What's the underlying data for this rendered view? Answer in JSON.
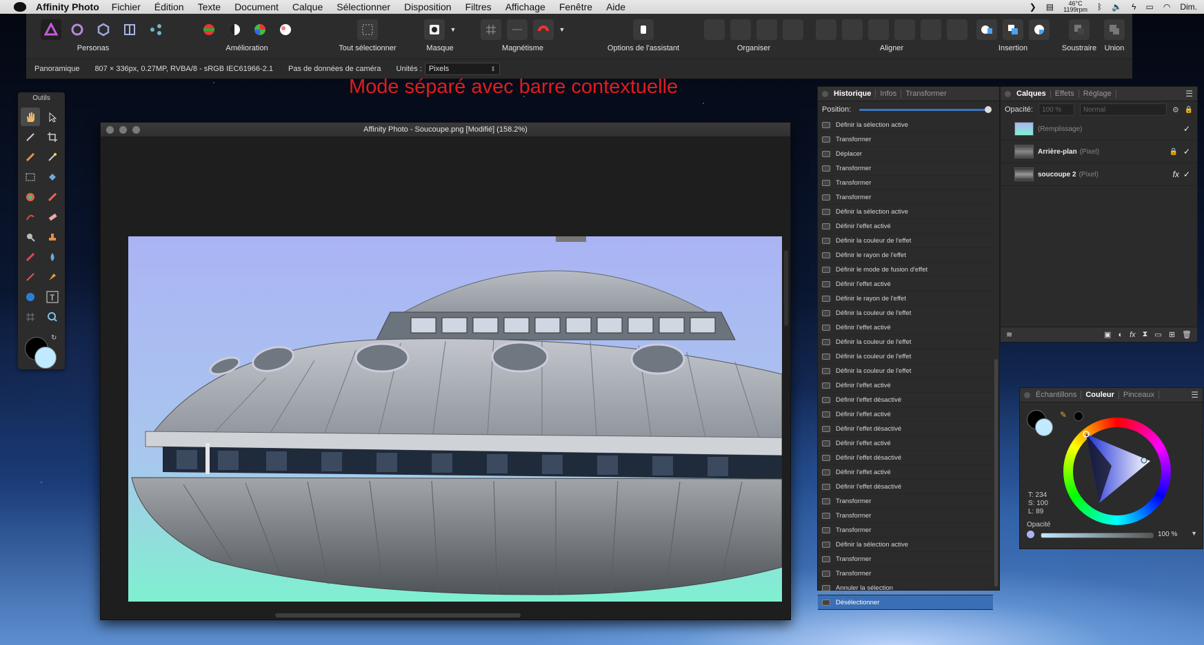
{
  "menubar": {
    "app_name": "Affinity Photo",
    "items": [
      "Fichier",
      "Édition",
      "Texte",
      "Document",
      "Calque",
      "Sélectionner",
      "Disposition",
      "Filtres",
      "Affichage",
      "Fenêtre",
      "Aide"
    ],
    "temp": "46°C",
    "rpm": "1199rpm",
    "user": "Dim."
  },
  "toolbar": {
    "personas_label": "Personas",
    "amelioration_label": "Amélioration",
    "select_all_label": "Tout sélectionner",
    "mask_label": "Masque",
    "snapping_label": "Magnétisme",
    "assistant_label": "Options de l'assistant",
    "arrange_label": "Organiser",
    "align_label": "Aligner",
    "insert_label": "Insertion",
    "subtract_label": "Soustraire",
    "union_label": "Union"
  },
  "context_bar": {
    "type": "Panoramique",
    "info": "807 × 336px, 0.27MP, RVBA/8 - sRGB IEC61966-2.1",
    "camera": "Pas de données de caméra",
    "units_label": "Unités :",
    "units_value": "Pixels"
  },
  "caption": "Mode séparé avec barre contextuelle",
  "tools_panel": {
    "title": "Outils"
  },
  "document": {
    "title": "Affinity Photo - Soucoupe.png [Modifié] (158.2%)"
  },
  "history_panel": {
    "tabs": [
      "Historique",
      "Infos",
      "Transformer"
    ],
    "active_tab": "Historique",
    "position_label": "Position:",
    "position_value": 1.0,
    "items": [
      "Définir la sélection active",
      "Transformer",
      "Déplacer",
      "Transformer",
      "Transformer",
      "Transformer",
      "Définir la sélection active",
      "Définir l'effet activé",
      "Définir la couleur de l'effet",
      "Définir le rayon de l'effet",
      "Définir le mode de fusion d'effet",
      "Définir l'effet activé",
      "Définir le rayon de l'effet",
      "Définir la couleur de l'effet",
      "Définir l'effet activé",
      "Définir la couleur de l'effet",
      "Définir la couleur de l'effet",
      "Définir la couleur de l'effet",
      "Définir l'effet activé",
      "Définir l'effet désactivé",
      "Définir l'effet activé",
      "Définir l'effet désactivé",
      "Définir l'effet activé",
      "Définir l'effet désactivé",
      "Définir l'effet activé",
      "Définir l'effet désactivé",
      "Transformer",
      "Transformer",
      "Transformer",
      "Définir la sélection active",
      "Transformer",
      "Transformer",
      "Annuler la sélection",
      "Désélectionner"
    ],
    "selected_index": 33
  },
  "layers_panel": {
    "tabs": [
      "Calques",
      "Effets",
      "Réglage"
    ],
    "active_tab": "Calques",
    "opacity_label": "Opacité:",
    "opacity_value": "100 %",
    "blend_mode": "Normal",
    "layers": [
      {
        "name": "(Remplissage)",
        "kind": "",
        "fx": false,
        "locked": false,
        "visible_mark": "✓"
      },
      {
        "name": "Arrière-plan",
        "kind": "(Pixel)",
        "fx": false,
        "locked": true,
        "visible_mark": "✓"
      },
      {
        "name": "soucoupe  2",
        "kind": "(Pixel)",
        "fx": true,
        "locked": false,
        "visible_mark": "✓"
      }
    ],
    "fx_label": "fx"
  },
  "color_panel": {
    "tabs": [
      "Échantillons",
      "Couleur",
      "Pinceaux"
    ],
    "active_tab": "Couleur",
    "t_value": "T: 234",
    "s_value": "S: 100",
    "l_value": "L: 89",
    "opacity_label": "Opacité",
    "opacity_value": "100 %"
  },
  "colors": {
    "accent": "#3b6fb5",
    "caption": "#e21c1c",
    "sky": "#aab8f0",
    "ground": "#7ff0d0"
  }
}
